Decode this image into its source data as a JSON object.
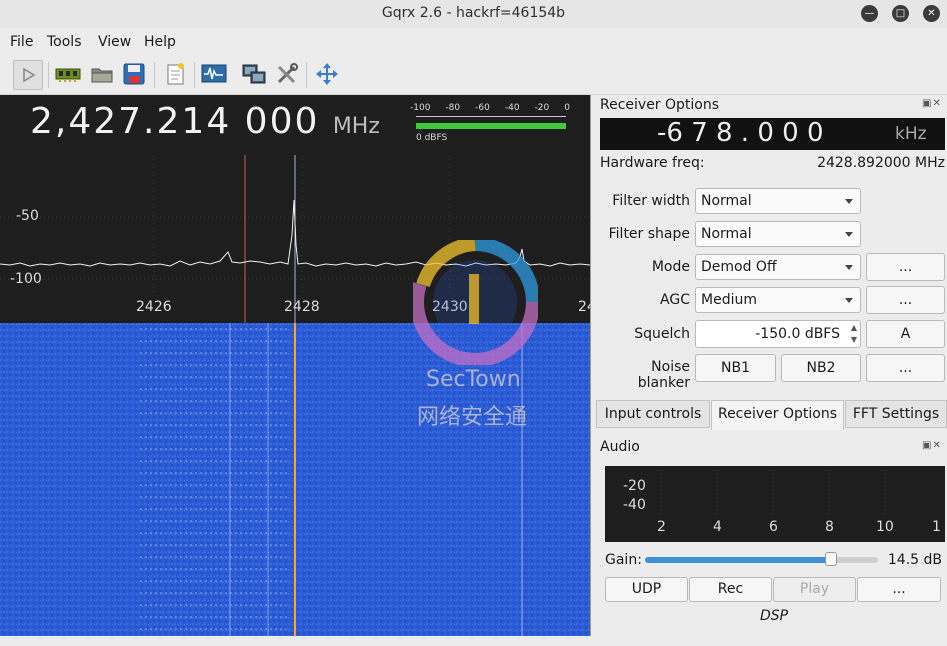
{
  "window": {
    "title": "Gqrx 2.6 - hackrf=46154b"
  },
  "menu": [
    "File",
    "Tools",
    "View",
    "Help"
  ],
  "toolbar": {
    "icons": [
      "play-icon",
      "hardware-icon",
      "folder-icon",
      "save-icon",
      "bookmark-icon",
      "waveform-icon",
      "remote-control-icon",
      "settings-icon",
      "fullscreen-icon"
    ]
  },
  "spectrum": {
    "frequency": "2,427.214 000",
    "frequency_unit": "MHz",
    "meter_scale": [
      "-100",
      "-80",
      "-60",
      "-40",
      "-20",
      "0"
    ],
    "meter_label": "0 dBFS",
    "db_labels": [
      "-50",
      "-100"
    ],
    "freq_labels": [
      "2426",
      "2428",
      "2430",
      "24"
    ],
    "watermark_text": "SecTown",
    "watermark_sub": "网络安全通",
    "colors": {
      "background": "#1e1e1e",
      "waterfall": "#2a5bd8",
      "filter_line": "#e8743b",
      "center_line": "#ffa31a",
      "marker_line": "#d65a5a"
    }
  },
  "receiver": {
    "title": "Receiver Options",
    "offset": "-6 7 8 . 0 0 0",
    "offset_unit": "kHz",
    "hw_label": "Hardware freq:",
    "hw_value": "2428.892000 MHz",
    "filter_width_label": "Filter width",
    "filter_width_value": "Normal",
    "filter_shape_label": "Filter shape",
    "filter_shape_value": "Normal",
    "mode_label": "Mode",
    "mode_value": "Demod Off",
    "mode_button": "...",
    "agc_label": "AGC",
    "agc_value": "Medium",
    "agc_button": "...",
    "squelch_label": "Squelch",
    "squelch_value": "-150.0 dBFS",
    "squelch_button": "A",
    "nb_label": "Noise blanker",
    "nb1": "NB1",
    "nb2": "NB2",
    "nb_button": "..."
  },
  "tabs": [
    {
      "label": "Input controls",
      "active": false
    },
    {
      "label": "Receiver Options",
      "active": true
    },
    {
      "label": "FFT Settings",
      "active": false
    }
  ],
  "audio": {
    "title": "Audio",
    "y_ticks": [
      "-20",
      "-40"
    ],
    "x_ticks": [
      "2",
      "4",
      "6",
      "8",
      "10",
      "1"
    ],
    "gain_label": "Gain:",
    "gain_value": "14.5 dB",
    "gain_fraction": 0.8,
    "udp": "UDP",
    "rec": "Rec",
    "play": "Play",
    "more": "...",
    "dsp": "DSP"
  }
}
